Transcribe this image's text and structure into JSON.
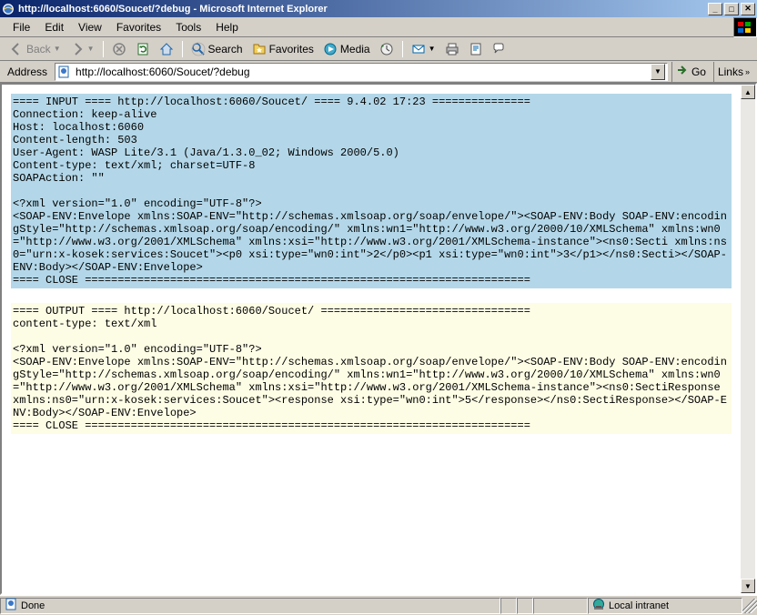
{
  "window": {
    "title": "http://localhost:6060/Soucet/?debug - Microsoft Internet Explorer"
  },
  "menu": {
    "items": [
      "File",
      "Edit",
      "View",
      "Favorites",
      "Tools",
      "Help"
    ]
  },
  "toolbar": {
    "back": "Back",
    "search": "Search",
    "favorites": "Favorites",
    "media": "Media"
  },
  "address": {
    "label": "Address",
    "url": "http://localhost:6060/Soucet/?debug",
    "go": "Go",
    "links": "Links"
  },
  "content": {
    "input_block": "==== INPUT ==== http://localhost:6060/Soucet/ ==== 9.4.02 17:23 ===============\nConnection: keep-alive\nHost: localhost:6060\nContent-length: 503\nUser-Agent: WASP Lite/3.1 (Java/1.3.0_02; Windows 2000/5.0)\nContent-type: text/xml; charset=UTF-8\nSOAPAction: \"\"\n\n<?xml version=\"1.0\" encoding=\"UTF-8\"?>\n<SOAP-ENV:Envelope xmlns:SOAP-ENV=\"http://schemas.xmlsoap.org/soap/envelope/\"><SOAP-ENV:Body SOAP-ENV:encodingStyle=\"http://schemas.xmlsoap.org/soap/encoding/\" xmlns:wn1=\"http://www.w3.org/2000/10/XMLSchema\" xmlns:wn0=\"http://www.w3.org/2001/XMLSchema\" xmlns:xsi=\"http://www.w3.org/2001/XMLSchema-instance\"><ns0:Secti xmlns:ns0=\"urn:x-kosek:services:Soucet\"><p0 xsi:type=\"wn0:int\">2</p0><p1 xsi:type=\"wn0:int\">3</p1></ns0:Secti></SOAP-ENV:Body></SOAP-ENV:Envelope>\n==== CLOSE ====================================================================",
    "output_block": "==== OUTPUT ==== http://localhost:6060/Soucet/ ================================\ncontent-type: text/xml\n\n<?xml version=\"1.0\" encoding=\"UTF-8\"?>\n<SOAP-ENV:Envelope xmlns:SOAP-ENV=\"http://schemas.xmlsoap.org/soap/envelope/\"><SOAP-ENV:Body SOAP-ENV:encodingStyle=\"http://schemas.xmlsoap.org/soap/encoding/\" xmlns:wn1=\"http://www.w3.org/2000/10/XMLSchema\" xmlns:wn0=\"http://www.w3.org/2001/XMLSchema\" xmlns:xsi=\"http://www.w3.org/2001/XMLSchema-instance\"><ns0:SectiResponse xmlns:ns0=\"urn:x-kosek:services:Soucet\"><response xsi:type=\"wn0:int\">5</response></ns0:SectiResponse></SOAP-ENV:Body></SOAP-ENV:Envelope>\n==== CLOSE ===================================================================="
  },
  "status": {
    "text": "Done",
    "zone": "Local intranet"
  }
}
